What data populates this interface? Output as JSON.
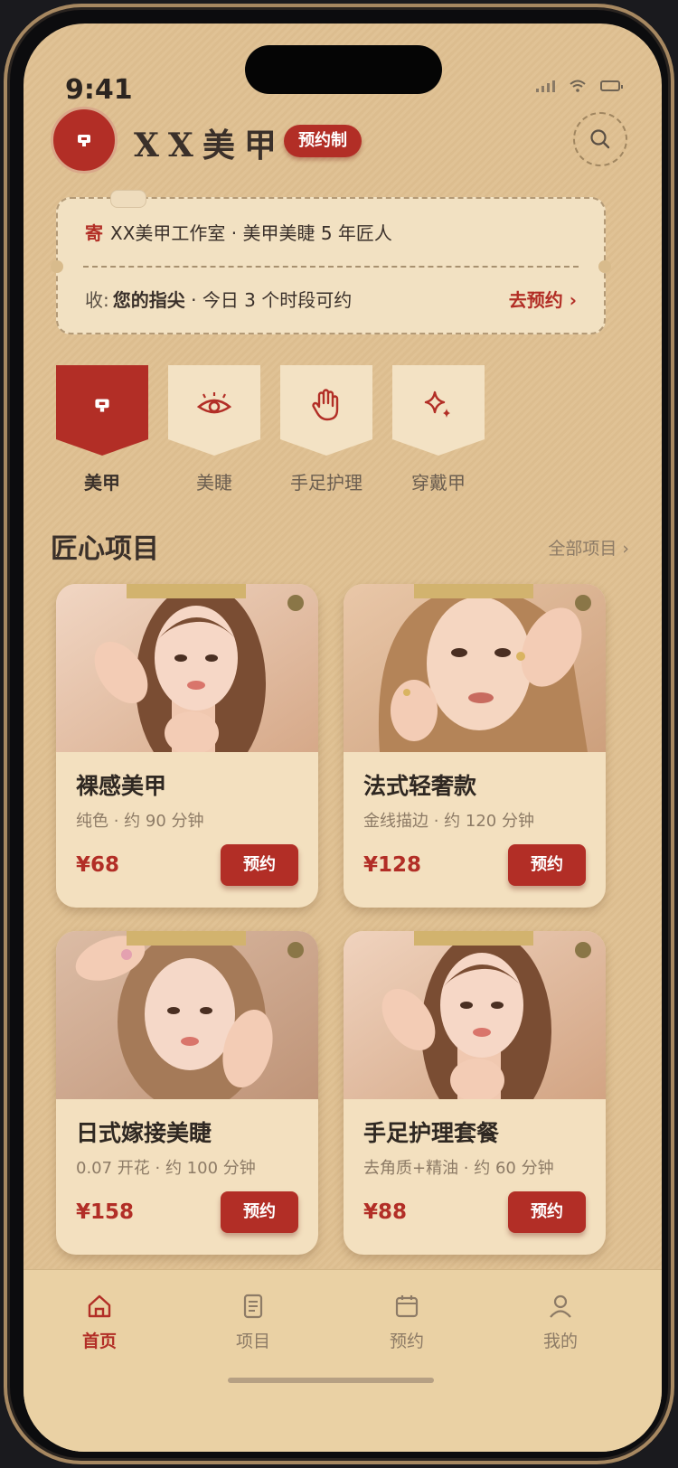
{
  "status": {
    "time": "9:41"
  },
  "header": {
    "brand": "XX美甲",
    "badge": "预约制"
  },
  "ticket": {
    "from_key": "寄",
    "from_text": "XX美甲工作室 · 美甲美睫 5 年匠人",
    "to_key": "收:",
    "to_bold": "您的指尖",
    "to_text": " · 今日 3 个时段可约",
    "cta": "去预约 ›"
  },
  "categories": [
    {
      "label": "美甲",
      "icon": "nail-polish-icon",
      "active": true
    },
    {
      "label": "美睫",
      "icon": "eye-icon",
      "active": false
    },
    {
      "label": "手足护理",
      "icon": "hand-icon",
      "active": false
    },
    {
      "label": "穿戴甲",
      "icon": "sparkle-icon",
      "active": false
    }
  ],
  "section": {
    "title": "匠心项目",
    "more": "全部项目 ›"
  },
  "products": [
    {
      "name": "裸感美甲",
      "desc": "纯色 · 约 90 分钟",
      "price": "¥68",
      "cta": "预约"
    },
    {
      "name": "法式轻奢款",
      "desc": "金线描边 · 约 120 分钟",
      "price": "¥128",
      "cta": "预约"
    },
    {
      "name": "日式嫁接美睫",
      "desc": "0.07 开花 · 约 100 分钟",
      "price": "¥158",
      "cta": "预约"
    },
    {
      "name": "手足护理套餐",
      "desc": "去角质+精油 · 约 60 分钟",
      "price": "¥88",
      "cta": "预约"
    }
  ],
  "tabs": [
    {
      "label": "首页",
      "icon": "home-icon",
      "active": true
    },
    {
      "label": "项目",
      "icon": "list-icon",
      "active": false
    },
    {
      "label": "预约",
      "icon": "calendar-icon",
      "active": false
    },
    {
      "label": "我的",
      "icon": "user-icon",
      "active": false
    }
  ],
  "colors": {
    "accent": "#b22e26",
    "background": "#e0c295",
    "card": "#f3e0bf",
    "text": "#3a302a"
  }
}
